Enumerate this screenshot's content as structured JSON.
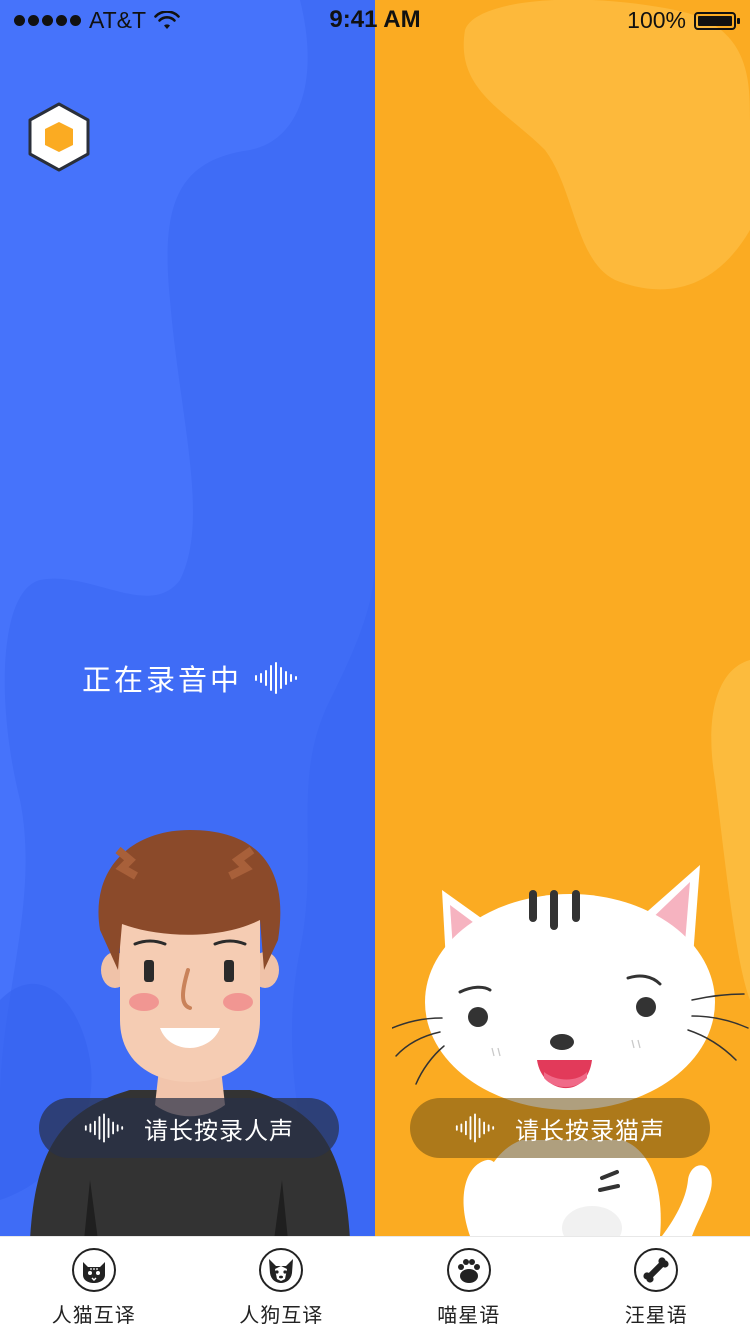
{
  "status_bar": {
    "carrier": "AT&T",
    "time": "9:41 AM",
    "battery_text": "100%",
    "battery_level": 1.0
  },
  "left_panel": {
    "color": "#3f6cf6",
    "recording_text": "正在录音中",
    "hold_label": "请长按录人声"
  },
  "right_panel": {
    "color": "#fbab22",
    "hold_label": "请长按录猫声"
  },
  "tabs": [
    {
      "label": "人猫互译",
      "icon": "cat-face-icon"
    },
    {
      "label": "人狗互译",
      "icon": "dog-face-icon"
    },
    {
      "label": "喵星语",
      "icon": "paw-icon"
    },
    {
      "label": "汪星语",
      "icon": "bone-icon"
    }
  ]
}
